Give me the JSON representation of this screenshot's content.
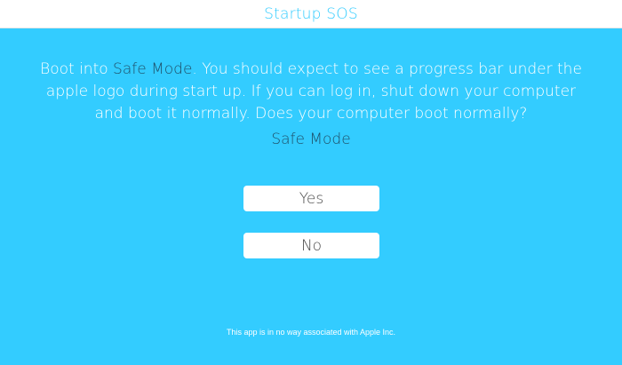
{
  "header": {
    "title": "Startup SOS"
  },
  "message": {
    "prefix": "Boot into ",
    "link_text": "Safe Mode",
    "suffix": ". You should expect to see a progress bar under the apple logo during start up. If you can log in, shut down your computer and boot it normally. Does your computer boot normally?"
  },
  "safe_mode_link": "Safe Mode",
  "buttons": {
    "yes": "Yes",
    "no": "No"
  },
  "footer": {
    "disclaimer": "This app is in no way associated with Apple Inc."
  },
  "colors": {
    "background": "#33ccff",
    "header_bg": "#ffffff",
    "title_color": "#33ccff",
    "link_color": "#1f4e67",
    "button_text": "#4a4a4a"
  }
}
